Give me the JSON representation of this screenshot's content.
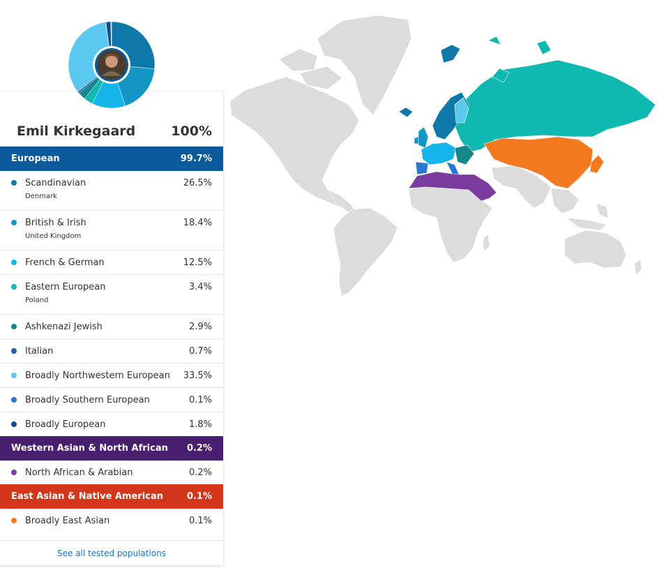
{
  "profile": {
    "name": "Emil Kirkegaard",
    "total": "100%"
  },
  "colors": {
    "european": "#0a5a9c",
    "western_asian": "#4a1e6e",
    "east_asian": "#d4361c",
    "map_base": "#dcdcdc"
  },
  "categories": [
    {
      "label": "European",
      "percent": "99.7%",
      "color": "#0a5a9c",
      "items": [
        {
          "label": "Scandinavian",
          "percent": "26.5%",
          "sub": "Denmark",
          "dot": "#0e79a8"
        },
        {
          "label": "British & Irish",
          "percent": "18.4%",
          "sub": "United Kingdom",
          "dot": "#1297c4"
        },
        {
          "label": "French & German",
          "percent": "12.5%",
          "dot": "#13b5ea"
        },
        {
          "label": "Eastern European",
          "percent": "3.4%",
          "sub": "Poland",
          "dot": "#0fb8b0"
        },
        {
          "label": "Ashkenazi Jewish",
          "percent": "2.9%",
          "dot": "#16888c"
        },
        {
          "label": "Italian",
          "percent": "0.7%",
          "dot": "#1f5fa0"
        },
        {
          "label": "Broadly Northwestern European",
          "percent": "33.5%",
          "dot": "#5bc8ef"
        },
        {
          "label": "Broadly Southern European",
          "percent": "0.1%",
          "dot": "#2a78d4"
        },
        {
          "label": "Broadly European",
          "percent": "1.8%",
          "dot": "#0c4e8a"
        }
      ]
    },
    {
      "label": "Western Asian & North African",
      "percent": "0.2%",
      "color": "#4a1e6e",
      "items": [
        {
          "label": "North African & Arabian",
          "percent": "0.2%",
          "dot": "#7a3a9e"
        }
      ]
    },
    {
      "label": "East Asian & Native American",
      "percent": "0.1%",
      "color": "#d4361c",
      "items": [
        {
          "label": "Broadly East Asian",
          "percent": "0.1%",
          "dot": "#f47a22"
        }
      ]
    }
  ],
  "footer": {
    "link_label": "See all tested populations"
  },
  "donut": [
    {
      "name": "Scandinavian",
      "value": 26.5,
      "color": "#0e79a8"
    },
    {
      "name": "British & Irish",
      "value": 18.4,
      "color": "#1297c4"
    },
    {
      "name": "French & German",
      "value": 12.5,
      "color": "#13b5ea"
    },
    {
      "name": "Eastern European",
      "value": 3.4,
      "color": "#0fb8b0"
    },
    {
      "name": "Ashkenazi Jewish",
      "value": 2.9,
      "color": "#16888c"
    },
    {
      "name": "Italian",
      "value": 0.7,
      "color": "#1f5fa0"
    },
    {
      "name": "Broadly Northwestern European",
      "value": 33.5,
      "color": "#5bc8ef"
    },
    {
      "name": "Broadly Southern European",
      "value": 0.1,
      "color": "#2a78d4"
    },
    {
      "name": "Broadly European",
      "value": 1.8,
      "color": "#0c4e8a"
    },
    {
      "name": "North African & Arabian",
      "value": 0.2,
      "color": "#7a3a9e"
    },
    {
      "name": "Broadly East Asian",
      "value": 0.1,
      "color": "#f47a22"
    }
  ],
  "map_regions": {
    "scandinavia": "#0e79a8",
    "british_isles": "#1297c4",
    "france_germany": "#13b5ea",
    "eastern_europe": "#0fb8b0",
    "southern_europe": "#2a78d4",
    "north_africa_arabia": "#7a3a9e",
    "east_asia": "#f47a22"
  }
}
